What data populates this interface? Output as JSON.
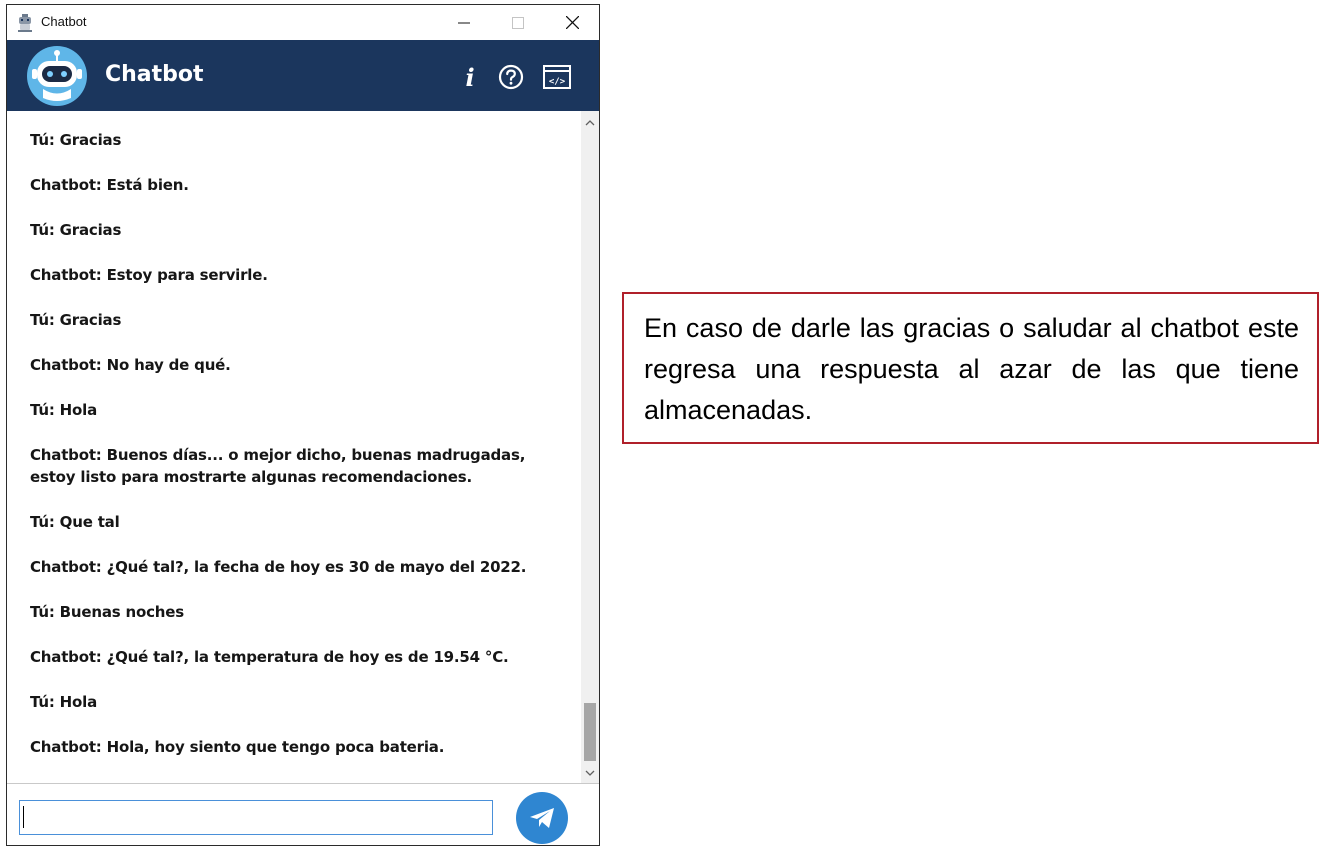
{
  "window": {
    "title": "Chatbot",
    "icon": "robot-icon",
    "controls": [
      "minimize-icon",
      "maximize-icon",
      "close-icon"
    ]
  },
  "header": {
    "title": "Chatbot",
    "avatar": "robot-avatar",
    "icons": [
      "info-icon",
      "help-icon",
      "code-icon"
    ],
    "background_color": "#1b365d"
  },
  "conversation": [
    {
      "text": "Tú: Gracias"
    },
    {
      "text": "Chatbot: Está bien."
    },
    {
      "text": "Tú: Gracias"
    },
    {
      "text": "Chatbot: Estoy para servirle."
    },
    {
      "text": "Tú: Gracias"
    },
    {
      "text": "Chatbot: No hay de qué."
    },
    {
      "text": "Tú: Hola"
    },
    {
      "text": "Chatbot: Buenos días... o mejor dicho, buenas madrugadas, estoy listo para mostrarte algunas recomendaciones."
    },
    {
      "text": "Tú: Que tal"
    },
    {
      "text": "Chatbot: ¿Qué tal?, la fecha de hoy es 30 de mayo del 2022."
    },
    {
      "text": "Tú: Buenas noches"
    },
    {
      "text": "Chatbot: ¿Qué tal?, la temperatura de hoy es de 19.54 °C."
    },
    {
      "text": "Tú: Hola"
    },
    {
      "text": "Chatbot: Hola, hoy siento que tengo poca bateria."
    }
  ],
  "input": {
    "value": "",
    "placeholder": ""
  },
  "send_button": {
    "icon": "paper-plane-icon",
    "color": "#2f86d1"
  },
  "annotation": {
    "text": "En caso de darle las gracias o saludar al chatbot este regresa una respuesta al azar de las que tiene almacenadas.",
    "border_color": "#b0202a"
  }
}
